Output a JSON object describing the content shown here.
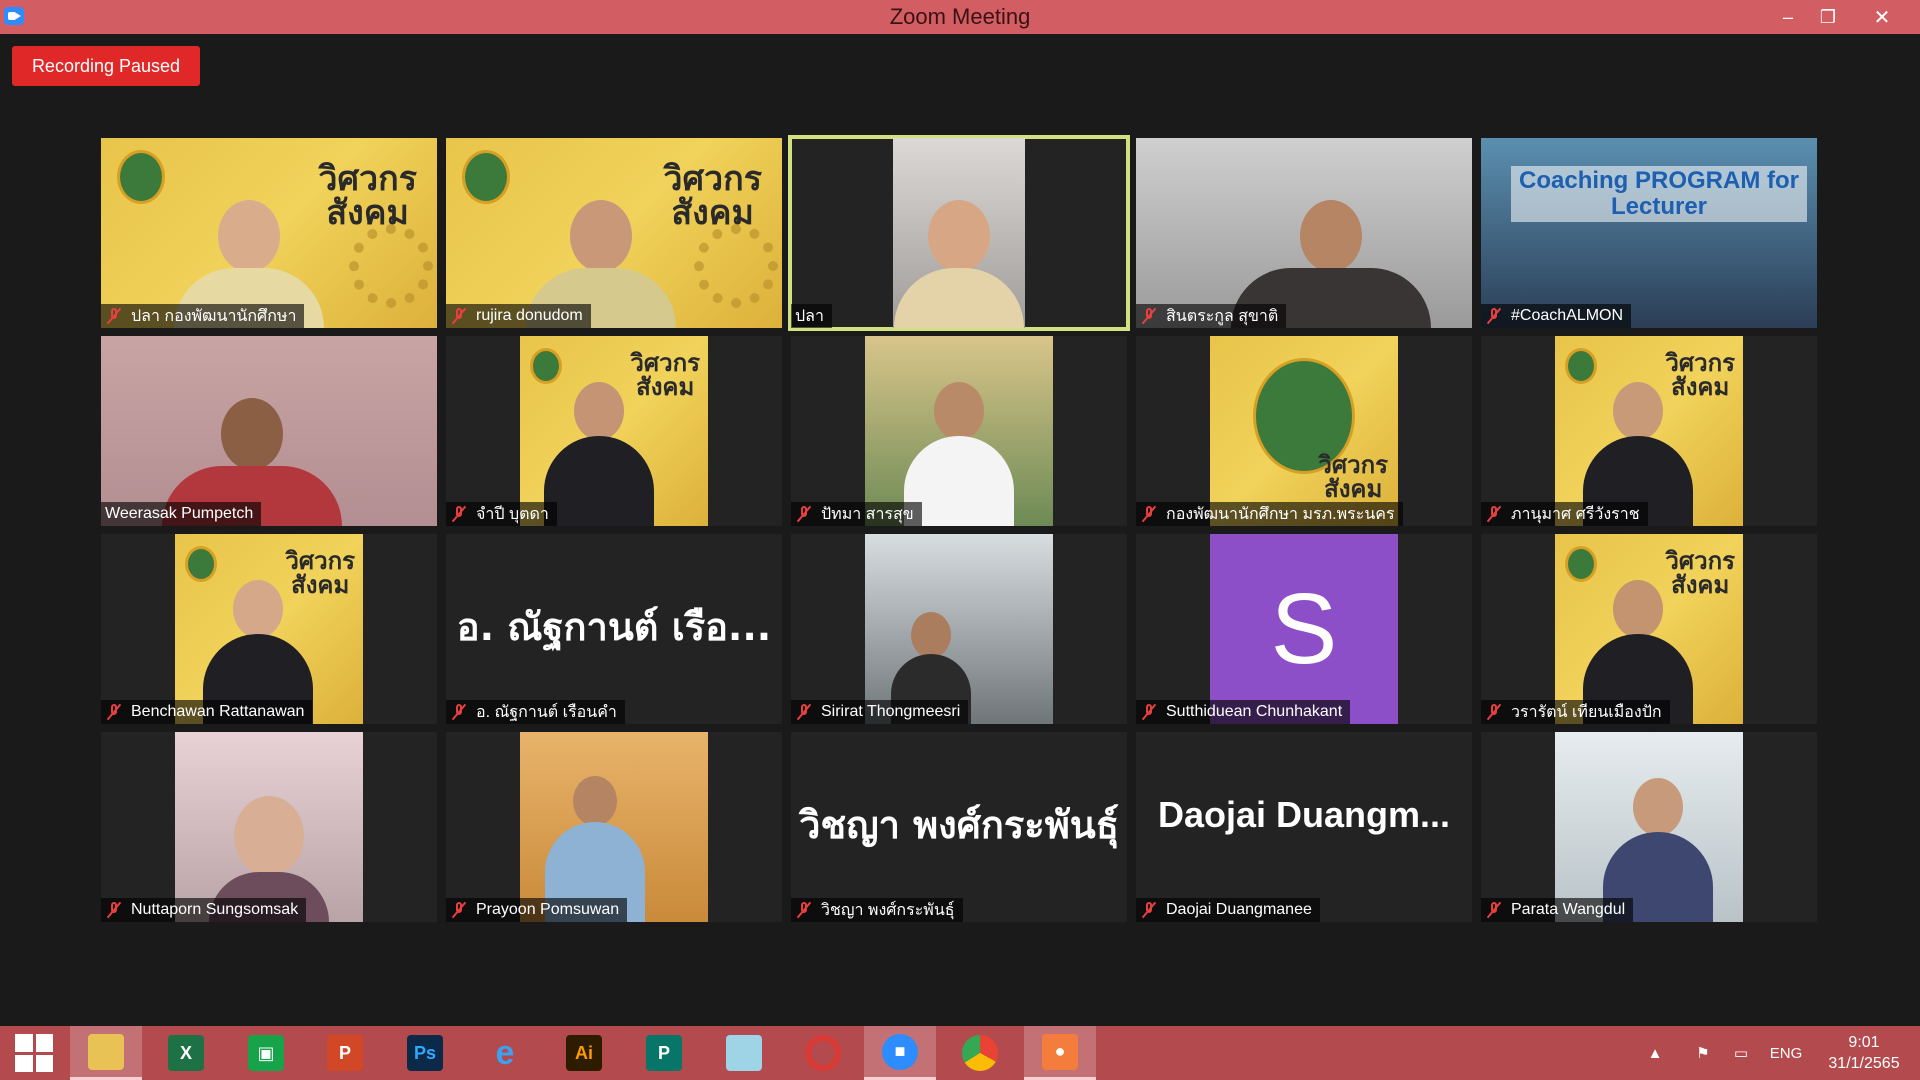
{
  "window": {
    "title": "Zoom Meeting",
    "minimize": "–",
    "maximize": "❐",
    "close": "✕"
  },
  "recording_badge": "Recording Paused",
  "participants": [
    {
      "name": "ปลา กองพัฒนานักศึกษา",
      "muted": true
    },
    {
      "name": "rujira donudom",
      "muted": true
    },
    {
      "name": "ปลา",
      "muted": false,
      "active_speaker": true
    },
    {
      "name": "สินตระกูล สุขาติ",
      "muted": true
    },
    {
      "name": "#CoachALMON",
      "muted": true,
      "video_text": "Coaching PROGRAM for Lecturer"
    },
    {
      "name": "Weerasak Pumpetch",
      "muted": false
    },
    {
      "name": "จำปี บุตดา",
      "muted": true
    },
    {
      "name": "ปัทมา สารสุข",
      "muted": true
    },
    {
      "name": "กองพัฒนานักศึกษา มรภ.พระนคร",
      "muted": true
    },
    {
      "name": "ภานุมาศ ศรีวังราช",
      "muted": true
    },
    {
      "name": "Benchawan Rattanawan",
      "muted": true
    },
    {
      "name": "อ. ณัฐกานต์ เรือนคำ",
      "muted": true,
      "display_text": "อ. ณัฐกานต์ เรือ..."
    },
    {
      "name": "Sirirat Thongmeesri",
      "muted": true
    },
    {
      "name": "Sutthiduean Chunhakant",
      "muted": true,
      "avatar_letter": "S"
    },
    {
      "name": "วรารัตน์ เทียนเมืองปัก",
      "muted": true
    },
    {
      "name": "Nuttaporn Sungsomsak",
      "muted": true
    },
    {
      "name": "Prayoon Pomsuwan",
      "muted": true
    },
    {
      "name": "วิชญา พงศ์กระพันธุ์",
      "muted": true,
      "display_text": "วิชญา พงศ์กระพันธุ์"
    },
    {
      "name": "Daojai Duangmanee",
      "muted": true,
      "display_text": "Daojai Duangm..."
    },
    {
      "name": "Parata Wangdul",
      "muted": true
    }
  ],
  "brand_overlay": "วิศวกร\nสังคม",
  "taskbar": {
    "apps": [
      "start",
      "file-explorer",
      "excel",
      "store",
      "powerpoint",
      "photoshop",
      "internet-explorer",
      "illustrator",
      "publisher",
      "notepad",
      "photoscape",
      "zoom",
      "chrome",
      "screen-recorder"
    ],
    "language": "ENG",
    "time": "9:01",
    "date": "31/1/2565"
  },
  "colors": {
    "titlebar": "#d25e63",
    "taskbar": "#b34a4e",
    "recording": "#e02828",
    "active_border": "#d3e07f",
    "avatar_purple": "#8d4fc7"
  }
}
